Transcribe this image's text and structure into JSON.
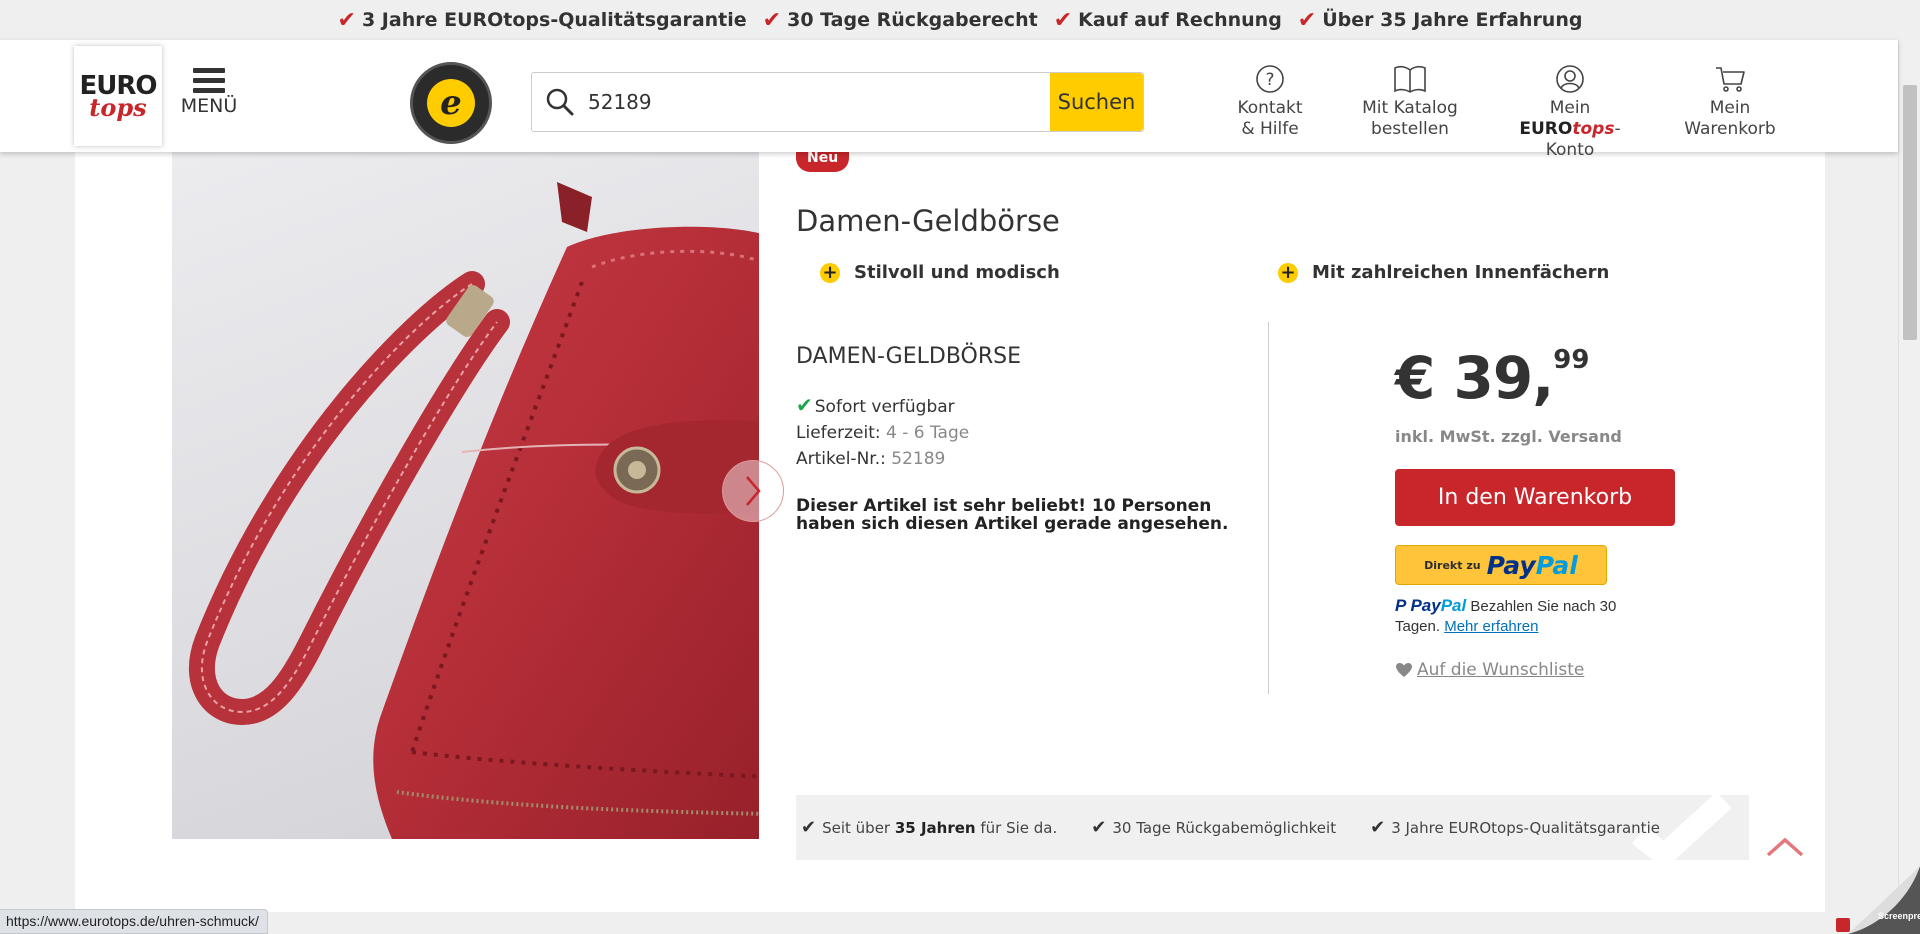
{
  "trustbar": {
    "items": [
      {
        "label": "3 Jahre EUROtops-Qualitätsgarantie"
      },
      {
        "label": "30 Tage Rückgaberecht"
      },
      {
        "label": "Kauf auf Rechnung"
      },
      {
        "label": "Über 35 Jahre Erfahrung"
      }
    ]
  },
  "header": {
    "logo_top": "EURO",
    "logo_bottom": "tops",
    "menu_label": "MENÜ",
    "seal_letter": "e",
    "search": {
      "value": "52189",
      "button": "Suchen"
    },
    "nav": {
      "contact_1": "Kontakt",
      "contact_2": "& Hilfe",
      "catalog_1": "Mit Katalog",
      "catalog_2": "bestellen",
      "account_pre": "Mein ",
      "account_brand": "EURO",
      "account_brand2": "tops",
      "account_dash": "-",
      "account_2": "Konto",
      "cart_1": "Mein",
      "cart_2": "Warenkorb"
    }
  },
  "product": {
    "badge": "Neu",
    "title": "Damen-Geldbörse",
    "features": [
      "Stilvoll und modisch",
      "Mit zahlreichen Innenfächern"
    ],
    "subtitle": "DAMEN-GELDBÖRSE",
    "availability": "Sofort verfügbar",
    "delivery_label": "Lieferzeit:",
    "delivery_value": "4 - 6 Tage",
    "article_label": "Artikel-Nr.:",
    "article_value": "52189",
    "popular": "Dieser Artikel ist sehr beliebt! 10 Personen haben sich diesen Artikel gerade angesehen.",
    "price_main": "€ 39,",
    "price_cents": "99",
    "tax_info": "inkl. MwSt. zzgl. Versand",
    "cart_button": "In den Warenkorb",
    "paypal_direct": "Direkt zu",
    "paypal_pay": "Pay",
    "paypal_pal": "Pal",
    "paypal_info": "Bezahlen Sie nach 30 Tagen.",
    "paypal_more": "Mehr erfahren",
    "wishlist": "Auf die Wunschliste"
  },
  "usp": {
    "item1_pre": "Seit über ",
    "item1_bold": "35 Jahren",
    "item1_post": " für Sie da.",
    "item2": "30 Tage Rückgabemöglichkeit",
    "item3": "3 Jahre EUROtops-Qualitätsgarantie"
  },
  "status_url": "https://www.eurotops.de/uhren-schmuck/",
  "watermark": "Screenpresso",
  "colors": {
    "brand_red": "#c8262b",
    "yellow": "#ffcc00",
    "paypal_yellow": "#ffc439",
    "check_green": "#19a54a"
  }
}
